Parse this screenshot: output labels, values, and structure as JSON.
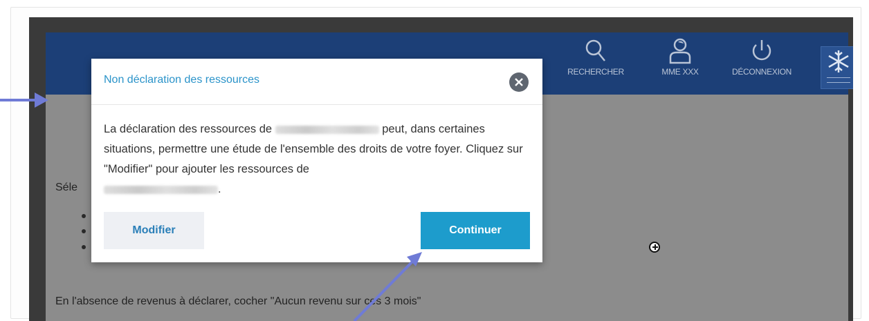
{
  "header": {
    "search_label": "RECHERCHER",
    "user_label": "MME XXX",
    "logout_label": "DÉCONNEXION",
    "icons": [
      "search-icon",
      "user-icon",
      "power-icon",
      "snowflake-logo-icon"
    ]
  },
  "content": {
    "select_fragment": "Séle",
    "bottom_instruction": "En l'absence de revenus à déclarer, cocher \"Aucun revenu sur ces 3 mois\""
  },
  "modal": {
    "title": "Non déclaration des ressources",
    "body_part1": "La déclaration des ressources de",
    "body_part2": "peut, dans certaines situations, permettre une étude de l'ensemble des droits de votre foyer. Cliquez sur \"Modifier\" pour ajouter les ressources de",
    "body_part3": ".",
    "modify_label": "Modifier",
    "continue_label": "Continuer"
  },
  "colors": {
    "header_bg": "#1c3f77",
    "modal_title": "#2a93c9",
    "primary_button": "#1d9ccc",
    "secondary_button": "#eef0f4",
    "annotation_arrow": "#6f7bd6"
  }
}
